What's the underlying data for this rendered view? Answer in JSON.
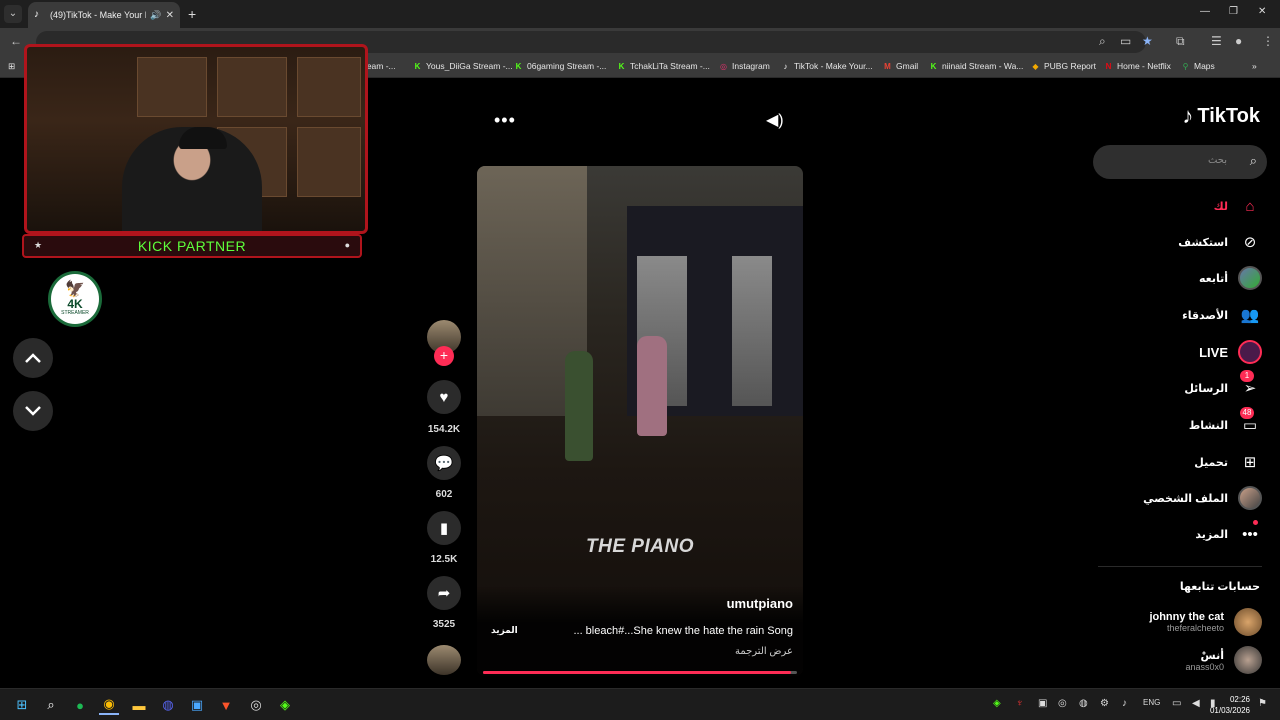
{
  "browser": {
    "tab_title": "(49)TikTok - Make Your Day",
    "new_tab": "+",
    "bookmarks": [
      {
        "label": "ream -...",
        "icon": "twitch-icon",
        "color": "#9146ff"
      },
      {
        "label": "Yous_DiiGa Stream -...",
        "icon": "kick-icon",
        "color": "#53fc18"
      },
      {
        "label": "06gaming Stream -...",
        "icon": "kick-icon",
        "color": "#53fc18"
      },
      {
        "label": "TchakLiTa Stream -...",
        "icon": "kick-icon",
        "color": "#53fc18"
      },
      {
        "label": "Instagram",
        "icon": "instagram-icon",
        "color": "#e1306c"
      },
      {
        "label": "TikTok - Make Your...",
        "icon": "tiktok-icon",
        "color": "#ffffff"
      },
      {
        "label": "Gmail",
        "icon": "gmail-icon",
        "color": "#ea4335"
      },
      {
        "label": "niinaid Stream - Wa...",
        "icon": "kick-icon",
        "color": "#53fc18"
      },
      {
        "label": "PUBG Report",
        "icon": "pubg-icon",
        "color": "#f2a900"
      },
      {
        "label": "Home - Netflix",
        "icon": "netflix-icon",
        "color": "#e50914"
      },
      {
        "label": "Maps",
        "icon": "maps-icon",
        "color": "#34a853"
      }
    ]
  },
  "overlay": {
    "partner_label": "KICK PARTNER",
    "logo_text": "4K",
    "logo_sub": "STREAMER"
  },
  "video": {
    "overlay_text": "THE PIANO",
    "handle": "umutpiano",
    "caption": "... bleach#...She knew the hate the rain Song",
    "more_label": "المزيد",
    "translate_label": "عرض الترجمة",
    "progress": 0.98
  },
  "actions": {
    "likes": "154.2K",
    "comments": "602",
    "saves": "12.5K",
    "shares": "3525"
  },
  "sidebar": {
    "logo": "TikTok",
    "search_placeholder": "بحث",
    "nav": [
      {
        "label": "لك",
        "icon": "home-icon",
        "active": true
      },
      {
        "label": "استكشف",
        "icon": "compass-icon"
      },
      {
        "label": "أتابعه",
        "icon": "following-avatar-icon"
      },
      {
        "label": "الأصدقاء",
        "icon": "friends-icon"
      },
      {
        "label": "LIVE",
        "icon": "live-icon"
      },
      {
        "label": "الرسائل",
        "icon": "messages-icon",
        "badge": "1"
      },
      {
        "label": "النشاط",
        "icon": "activity-icon",
        "badge": "48"
      },
      {
        "label": "تحميل",
        "icon": "upload-icon"
      },
      {
        "label": "الملف الشخصي",
        "icon": "profile-avatar-icon"
      },
      {
        "label": "المزيد",
        "icon": "more-icon"
      }
    ],
    "following_heading": "حسابات تتابعها",
    "accounts": [
      {
        "name": "johnny the cat",
        "handle": "theferalcheeto"
      },
      {
        "name": "أنسْ",
        "handle": "anass0x0"
      }
    ]
  },
  "taskbar": {
    "lang": "ENG",
    "time": "02:26",
    "date": "01/03/2026"
  },
  "colors": {
    "accent": "#fe2c55",
    "kick_green": "#53fc18"
  }
}
